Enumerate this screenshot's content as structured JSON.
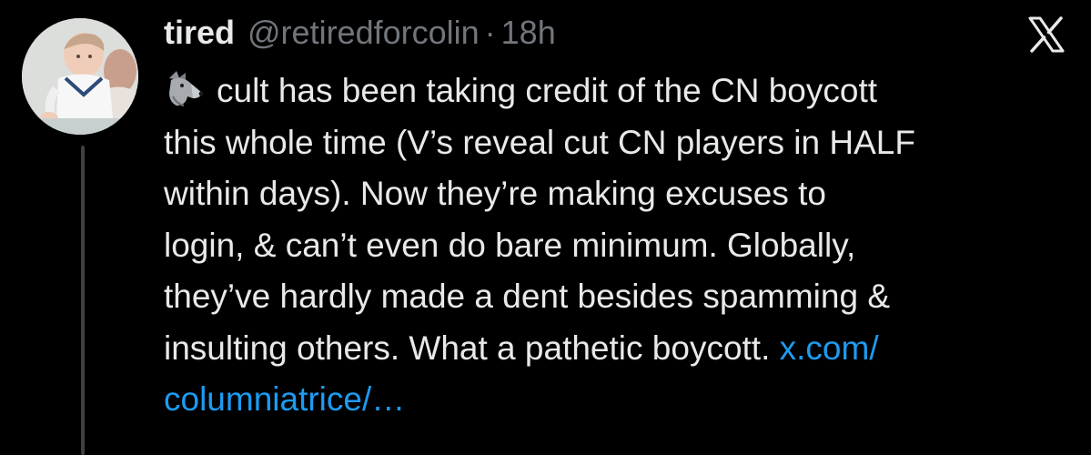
{
  "tweet": {
    "display_name": "tired",
    "handle": "@retiredforcolin",
    "separator": "·",
    "time": "18h",
    "emoji": "wolf-icon",
    "lines": [
      "cult has been taking credit of the CN boycott",
      "this whole time (V’s reveal cut CN players in HALF",
      "within days). Now they’re making excuses to",
      "login, & can’t even do bare minimum. Globally,",
      "they’ve hardly made a dent besides spamming &",
      "insulting others. What a pathetic boycott."
    ],
    "link_part1": "x.com/",
    "link_part2": "columniatrice/…"
  },
  "colors": {
    "background": "#000000",
    "text": "#e7e9ea",
    "muted": "#71767b",
    "link": "#1d9bf0",
    "thread_line": "#3e4144"
  }
}
